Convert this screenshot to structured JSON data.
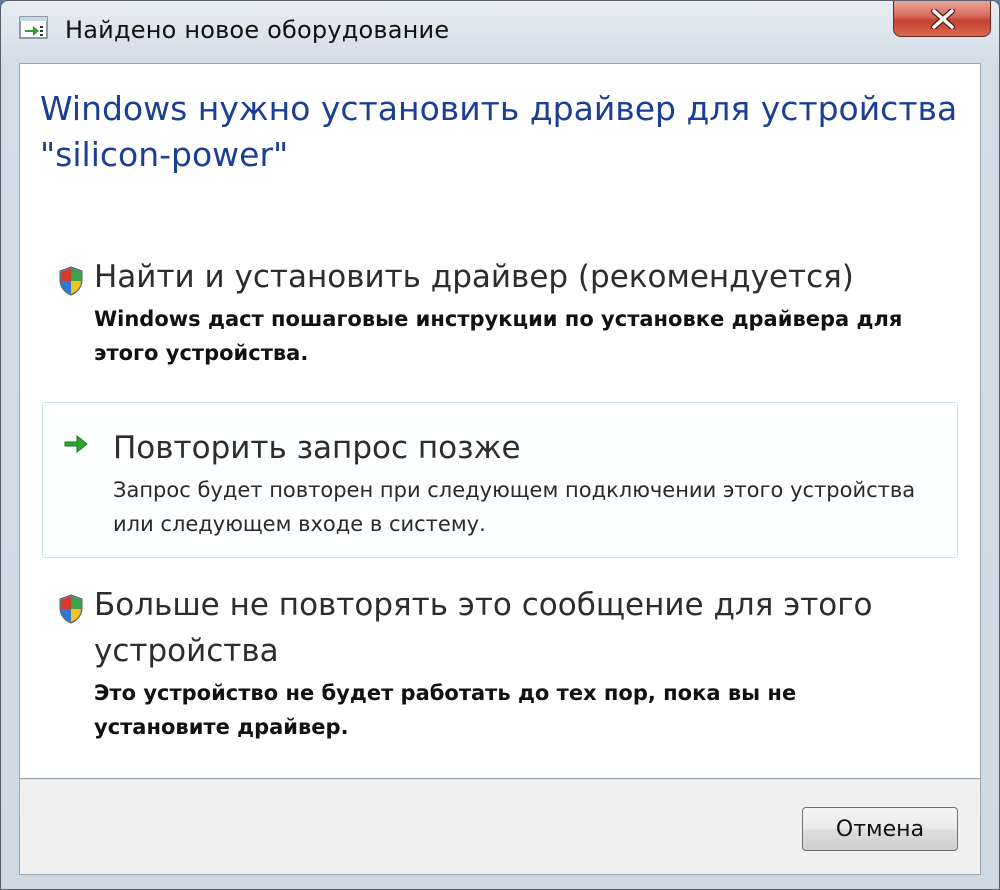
{
  "window": {
    "title": "Найдено новое оборудование"
  },
  "heading": "Windows нужно установить драйвер для устройства \"silicon-power\"",
  "options": [
    {
      "title": "Найти и установить драйвер (рекомендуется)",
      "description": "Windows даст пошаговые инструкции по установке драйвера для этого устройства.",
      "icon": "shield-icon"
    },
    {
      "title": "Повторить запрос позже",
      "description": "Запрос будет повторен при следующем подключении этого устройства или следующем входе в систему.",
      "icon": "green-arrow-icon"
    },
    {
      "title": "Больше не повторять это сообщение для этого устройства",
      "description": "Это устройство не будет работать до тех пор, пока вы не установите драйвер.",
      "icon": "shield-icon"
    }
  ],
  "footer": {
    "cancel_label": "Отмена"
  },
  "colors": {
    "heading": "#1a3f95",
    "close_button": "#c5412f",
    "highlight_border": "#c9e2f2"
  }
}
